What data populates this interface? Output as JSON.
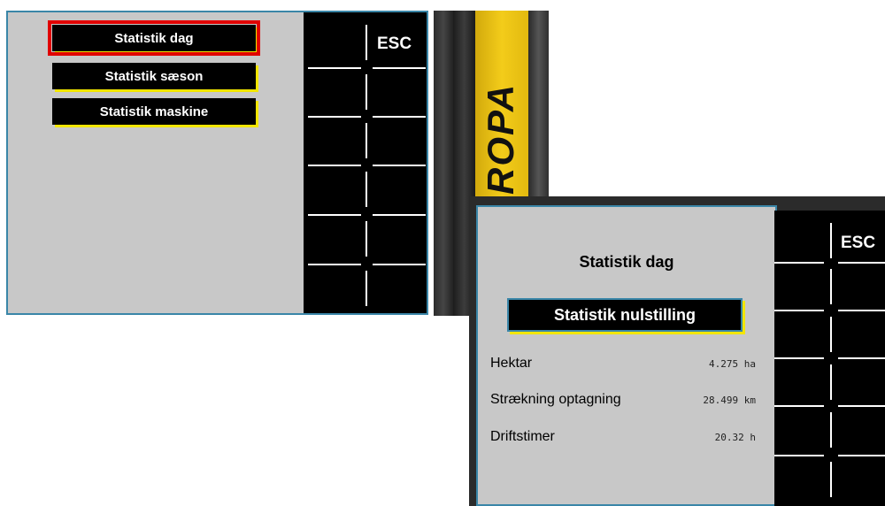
{
  "screen1": {
    "menu": [
      {
        "label": "Statistik dag",
        "selected": true
      },
      {
        "label": "Statistik sæson",
        "selected": false
      },
      {
        "label": "Statistik maskine",
        "selected": false
      }
    ],
    "softkey_esc": "ESC"
  },
  "photo": {
    "logo_text": "ROPA",
    "logo_color": "#f3cc1a"
  },
  "screen2": {
    "title": "Statistik dag",
    "reset_button": "Statistik nulstilling",
    "rows": [
      {
        "label": "Hektar",
        "value": "4.275 ha"
      },
      {
        "label": "Strækning optagning",
        "value": "28.499 km"
      },
      {
        "label": "Driftstimer",
        "value": "20.32 h"
      }
    ],
    "softkey_esc": "ESC"
  },
  "colors": {
    "highlight": "#e00000",
    "accent_yellow": "#f2e600",
    "frame": "#3a86a8",
    "panel": "#c8c8c8"
  }
}
